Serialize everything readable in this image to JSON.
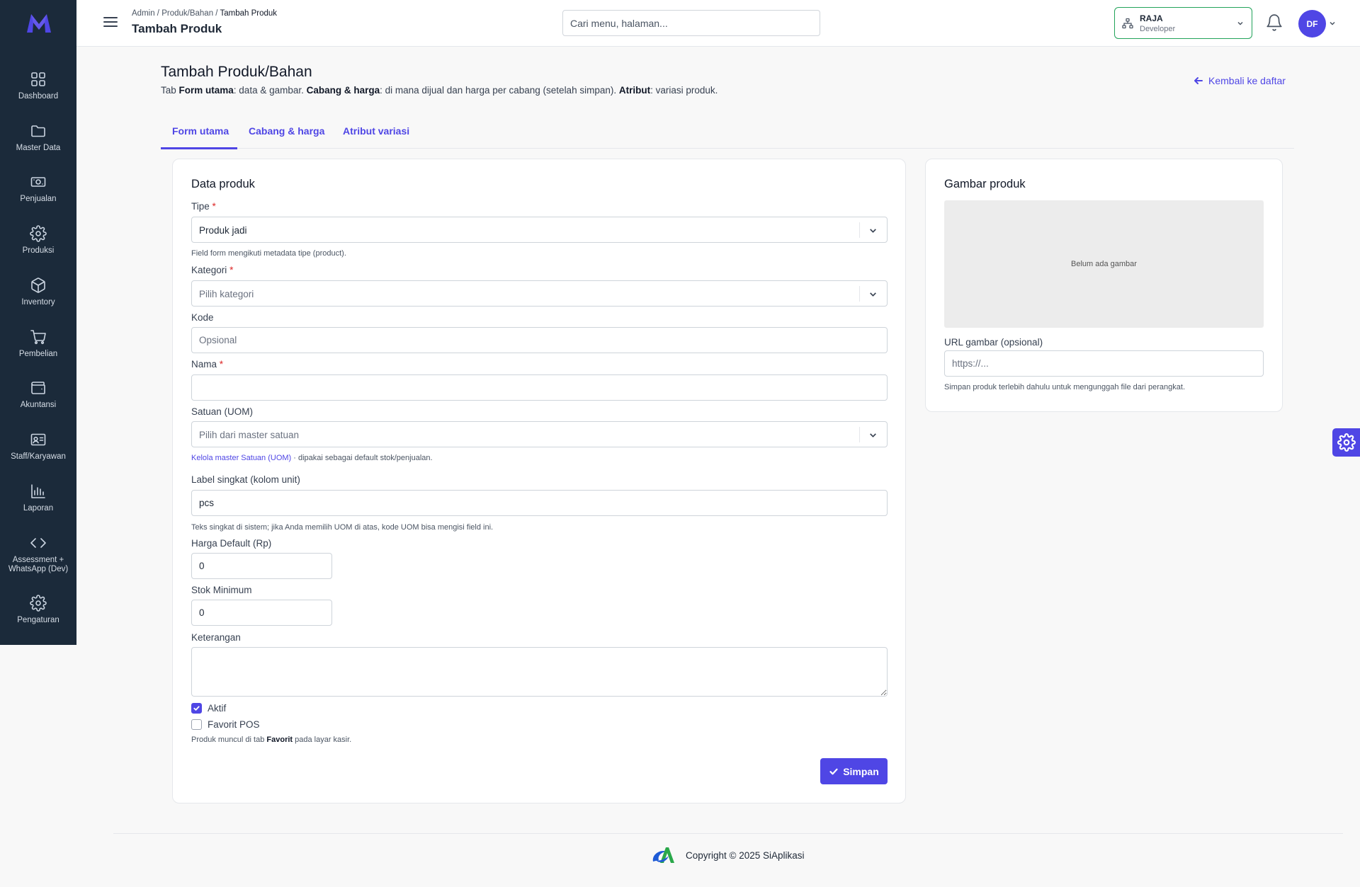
{
  "sidebar": {
    "items": [
      {
        "label": "Dashboard",
        "icon": "grid-icon"
      },
      {
        "label": "Master Data",
        "icon": "folder-icon"
      },
      {
        "label": "Penjualan",
        "icon": "cash-icon"
      },
      {
        "label": "Produksi",
        "icon": "gear-icon"
      },
      {
        "label": "Inventory",
        "icon": "box-icon"
      },
      {
        "label": "Pembelian",
        "icon": "cart-icon"
      },
      {
        "label": "Akuntansi",
        "icon": "wallet-icon"
      },
      {
        "label": "Staff/Karyawan",
        "icon": "id-card-icon"
      },
      {
        "label": "Laporan",
        "icon": "bar-chart-icon"
      },
      {
        "label": "Assessment + WhatsApp (Dev)",
        "icon": "code-icon"
      },
      {
        "label": "Pengaturan",
        "icon": "gear-icon"
      }
    ]
  },
  "topbar": {
    "breadcrumb": {
      "part1": "Admin",
      "sep": " / ",
      "part2": "Produk/Bahan",
      "current": "Tambah Produk"
    },
    "title": "Tambah Produk",
    "search_placeholder": "Cari menu, halaman...",
    "branch": {
      "name": "RAJA",
      "role": "Developer"
    },
    "avatar_initials": "DF"
  },
  "page": {
    "title": "Tambah Produk/Bahan",
    "desc": {
      "t1": "Tab ",
      "b1": "Form utama",
      "t2": ": data & gambar. ",
      "b2": "Cabang & harga",
      "t3": ": di mana dijual dan harga per cabang (setelah simpan). ",
      "b3": "Atribut",
      "t4": ": variasi produk."
    },
    "back_link": "Kembali ke daftar"
  },
  "tabs": [
    {
      "label": "Form utama",
      "active": true
    },
    {
      "label": "Cabang & harga",
      "active": false
    },
    {
      "label": "Atribut variasi",
      "active": false
    }
  ],
  "form": {
    "section_title": "Data produk",
    "tipe": {
      "label": "Tipe",
      "required": "*",
      "value": "Produk jadi",
      "hint": "Field form mengikuti metadata tipe (product)."
    },
    "kategori": {
      "label": "Kategori",
      "required": "*",
      "placeholder": "Pilih kategori"
    },
    "kode": {
      "label": "Kode",
      "placeholder": "Opsional",
      "value": ""
    },
    "nama": {
      "label": "Nama",
      "required": "*",
      "value": ""
    },
    "satuan": {
      "label": "Satuan (UOM)",
      "placeholder": "Pilih dari master satuan",
      "hint_link": "Kelola master Satuan (UOM)",
      "hint_rest": " · dipakai sebagai default stok/penjualan."
    },
    "label_singkat": {
      "label": "Label singkat (kolom unit)",
      "value": "pcs",
      "hint": "Teks singkat di sistem; jika Anda memilih UOM di atas, kode UOM bisa mengisi field ini."
    },
    "harga_default": {
      "label": "Harga Default (Rp)",
      "value": "0"
    },
    "stok_minimum": {
      "label": "Stok Minimum",
      "value": "0"
    },
    "keterangan": {
      "label": "Keterangan",
      "value": ""
    },
    "aktif": {
      "label": "Aktif",
      "checked": true
    },
    "favorit_pos": {
      "label": "Favorit POS",
      "checked": false
    },
    "favorit_hint": {
      "t1": "Produk muncul di tab ",
      "b": "Favorit",
      "t2": " pada layar kasir."
    },
    "save_label": "Simpan"
  },
  "image_panel": {
    "title": "Gambar produk",
    "empty_text": "Belum ada gambar",
    "url_label": "URL gambar (opsional)",
    "url_placeholder": "https://...",
    "hint": "Simpan produk terlebih dahulu untuk mengunggah file dari perangkat."
  },
  "footer": {
    "copyright": "Copyright © 2025 SiAplikasi"
  },
  "colors": {
    "accent": "#4f46e5",
    "sidebar_bg": "#1b2a3a",
    "branch_border": "#22a35a",
    "required": "#dc2626"
  }
}
